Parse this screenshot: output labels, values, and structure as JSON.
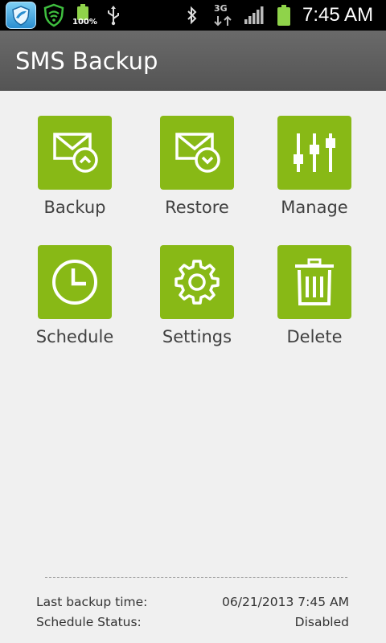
{
  "status_bar": {
    "battery_percent": "100%",
    "network_type": "3G",
    "time": "7:45 AM"
  },
  "app": {
    "title": "SMS Backup",
    "accent": "#88b916"
  },
  "grid": [
    {
      "label": "Backup",
      "icon": "envelope-up-icon"
    },
    {
      "label": "Restore",
      "icon": "envelope-down-icon"
    },
    {
      "label": "Manage",
      "icon": "sliders-icon"
    },
    {
      "label": "Schedule",
      "icon": "clock-icon"
    },
    {
      "label": "Settings",
      "icon": "gear-icon"
    },
    {
      "label": "Delete",
      "icon": "trash-icon"
    }
  ],
  "footer": {
    "last_backup_label": "Last backup time:",
    "last_backup_value": "06/21/2013 7:45 AM",
    "schedule_status_label": "Schedule Status:",
    "schedule_status_value": "Disabled"
  }
}
